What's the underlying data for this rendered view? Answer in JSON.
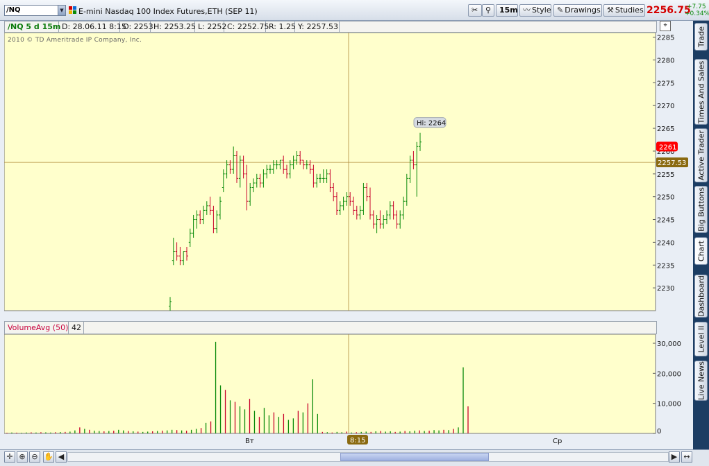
{
  "toolbar": {
    "symbol": "/NQ",
    "instrument": "E-mini Nasdaq 100 Index Futures,ETH (SEP 11)",
    "timeframe": "15m",
    "style_label": "Style",
    "drawings_label": "Drawings",
    "studies_label": "Studies",
    "last_price": "2256.75",
    "change_abs": "+7.75",
    "change_pct": "+0.34%"
  },
  "side_tabs": [
    "Trade",
    "Times And Sales",
    "Active Trader",
    "Big Buttons",
    "Chart",
    "Dashboard",
    "Level II",
    "Live News"
  ],
  "price_header": {
    "symbol": "/NQ 5 d 15m",
    "date": "D: 28.06.11 8:15",
    "open": "O: 2253",
    "high": "H: 2253.25",
    "low": "L: 2252",
    "close": "C: 2252.75",
    "range": "R: 1.25",
    "y": "Y: 2257.53"
  },
  "copyright": "2010 © TD Ameritrade IP Company, Inc.",
  "volume_header": {
    "study": "VolumeAvg (50)",
    "value": "42"
  },
  "x_labels": {
    "day1": "Вт",
    "cursor": "8:15",
    "day2": "Ср"
  },
  "colors": {
    "chart_bg": "#ffffcc",
    "up": "#0a8a0a",
    "down": "#c8002a",
    "crosshair": "#b08b3a",
    "last_marker": "#ff0000",
    "cursor_marker": "#8a6a10"
  },
  "chart_data": [
    {
      "type": "ohlc",
      "ylim": [
        2225,
        2286
      ],
      "yticks": [
        "2285",
        "2280",
        "2275",
        "2270",
        "2265",
        "2260",
        "2255",
        "2250",
        "2245",
        "2240",
        "2235",
        "2230"
      ],
      "y_cursor": 2257.53,
      "hi_label": "Hi: 2264",
      "last_marker": "2261",
      "y_cursor_label": "2257.53",
      "cursor_bar_index": 43,
      "bars_ohlc": [
        [
          2226,
          2228,
          2225,
          2227
        ],
        [
          2236,
          2241,
          2235,
          2238
        ],
        [
          2238,
          2240,
          2236,
          2237
        ],
        [
          2237,
          2239,
          2235,
          2236
        ],
        [
          2236,
          2238,
          2235,
          2238
        ],
        [
          2238,
          2239,
          2236,
          2237
        ],
        [
          2240,
          2243,
          2239,
          2242
        ],
        [
          2242,
          2246,
          2241,
          2245
        ],
        [
          2245,
          2247,
          2243,
          2246
        ],
        [
          2246,
          2247,
          2244,
          2245
        ],
        [
          2245,
          2248,
          2244,
          2247
        ],
        [
          2247,
          2249,
          2246,
          2248
        ],
        [
          2248,
          2250,
          2246,
          2247
        ],
        [
          2247,
          2248,
          2242,
          2243
        ],
        [
          2243,
          2247,
          2242,
          2246
        ],
        [
          2246,
          2250,
          2245,
          2249
        ],
        [
          2252,
          2256,
          2251,
          2255
        ],
        [
          2255,
          2258,
          2254,
          2257
        ],
        [
          2257,
          2258,
          2255,
          2256
        ],
        [
          2256,
          2261,
          2255,
          2259
        ],
        [
          2259,
          2260,
          2253,
          2254
        ],
        [
          2254,
          2259,
          2252,
          2258
        ],
        [
          2258,
          2259,
          2254,
          2255
        ],
        [
          2255,
          2257,
          2247,
          2249
        ],
        [
          2249,
          2253,
          2248,
          2252
        ],
        [
          2252,
          2254,
          2251,
          2253
        ],
        [
          2253,
          2255,
          2252,
          2254
        ],
        [
          2254,
          2255,
          2252,
          2253
        ],
        [
          2253,
          2256,
          2252,
          2255
        ],
        [
          2255,
          2257,
          2254,
          2256
        ],
        [
          2256,
          2257,
          2255,
          2256
        ],
        [
          2256,
          2258,
          2255,
          2257
        ],
        [
          2257,
          2258,
          2256,
          2257
        ],
        [
          2257,
          2258,
          2256,
          2258
        ],
        [
          2258,
          2259,
          2255,
          2256
        ],
        [
          2256,
          2257,
          2254,
          2255
        ],
        [
          2255,
          2258,
          2254,
          2257
        ],
        [
          2257,
          2259,
          2256,
          2258
        ],
        [
          2258,
          2260,
          2257,
          2259
        ],
        [
          2259,
          2260,
          2257,
          2258
        ],
        [
          2258,
          2258,
          2256,
          2257
        ],
        [
          2257,
          2258,
          2256,
          2257
        ],
        [
          2257,
          2258,
          2255,
          2256
        ],
        [
          2256,
          2257,
          2252,
          2253
        ],
        [
          2253,
          2255,
          2252,
          2254
        ],
        [
          2254,
          2255,
          2253,
          2254
        ],
        [
          2254,
          2256,
          2253,
          2254
        ],
        [
          2254,
          2256,
          2253,
          2255
        ],
        [
          2255,
          2256,
          2251,
          2252
        ],
        [
          2252,
          2253,
          2249,
          2250
        ],
        [
          2250,
          2251,
          2246,
          2247
        ],
        [
          2247,
          2249,
          2246,
          2248
        ],
        [
          2248,
          2250,
          2247,
          2249
        ],
        [
          2249,
          2251,
          2248,
          2250
        ],
        [
          2250,
          2251,
          2248,
          2249
        ],
        [
          2249,
          2250,
          2246,
          2247
        ],
        [
          2247,
          2248,
          2245,
          2246
        ],
        [
          2246,
          2248,
          2245,
          2247
        ],
        [
          2247,
          2253,
          2246,
          2252
        ],
        [
          2252,
          2253,
          2249,
          2250
        ],
        [
          2250,
          2252,
          2245,
          2246
        ],
        [
          2246,
          2247,
          2243,
          2244
        ],
        [
          2244,
          2246,
          2242,
          2245
        ],
        [
          2245,
          2247,
          2243,
          2244
        ],
        [
          2244,
          2246,
          2243,
          2245
        ],
        [
          2245,
          2247,
          2244,
          2246
        ],
        [
          2246,
          2249,
          2245,
          2248
        ],
        [
          2248,
          2249,
          2245,
          2246
        ],
        [
          2246,
          2247,
          2243,
          2244
        ],
        [
          2244,
          2247,
          2243,
          2246
        ],
        [
          2246,
          2250,
          2245,
          2249
        ],
        [
          2249,
          2255,
          2248,
          2254
        ],
        [
          2254,
          2259,
          2253,
          2258
        ],
        [
          2258,
          2260,
          2256,
          2257
        ],
        [
          2257,
          2262,
          2250,
          2261
        ],
        [
          2261,
          2264,
          2260,
          2262
        ]
      ]
    },
    {
      "type": "bar",
      "ylim": [
        0,
        33000
      ],
      "yticks": [
        "30,000",
        "20,000",
        "10,000",
        "0"
      ],
      "series_name": "VolumeAvg (50)",
      "values": [
        200,
        300,
        250,
        200,
        300,
        350,
        300,
        400,
        350,
        300,
        400,
        450,
        500,
        600,
        1000,
        2000,
        1500,
        1200,
        900,
        800,
        700,
        800,
        900,
        1200,
        1000,
        800,
        700,
        600,
        500,
        600,
        700,
        800,
        900,
        1000,
        1200,
        1100,
        1000,
        900,
        1200,
        1500,
        1800,
        3500,
        4000,
        30500,
        16000,
        14500,
        11000,
        10500,
        9000,
        8000,
        11500,
        7500,
        5500,
        8500,
        6000,
        7000,
        5500,
        6500,
        4500,
        5000,
        7500,
        7000,
        10000,
        18000,
        6500,
        500,
        400,
        300,
        500,
        400,
        600,
        300,
        400,
        500,
        600,
        500,
        700,
        800,
        600,
        700,
        500,
        600,
        800,
        700,
        900,
        1000,
        800,
        900,
        1100,
        1000,
        1200,
        1100,
        1500,
        2000,
        22000,
        9000
      ],
      "colors_up": [
        0,
        1,
        0,
        1,
        1,
        0,
        1,
        0,
        1,
        1
      ]
    }
  ]
}
